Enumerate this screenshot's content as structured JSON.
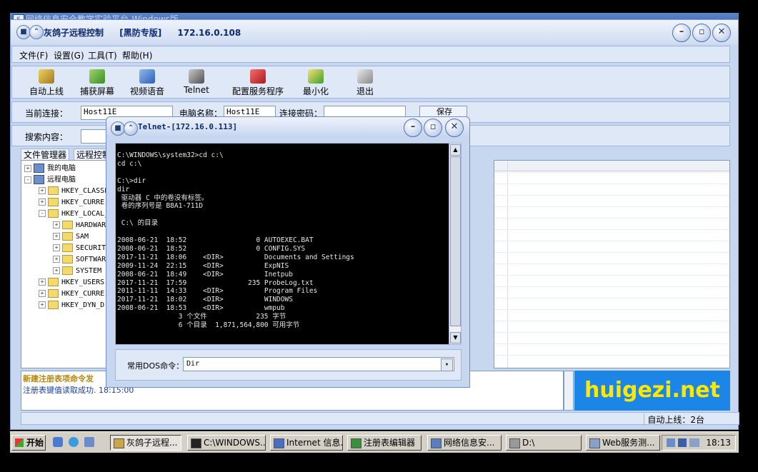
{
  "outer_window": {
    "title": "网络信息安全教学实验平台-Windows版"
  },
  "app": {
    "title": "灰鸽子远程控制",
    "edition": "[黑防专版]",
    "ip": "172.16.0.108"
  },
  "menu": [
    "文件(F)",
    "设置(G)",
    "工具(T)",
    "帮助(H)"
  ],
  "toolbar": [
    {
      "label": "自动上线",
      "icon": "auto-online-icon"
    },
    {
      "label": "捕获屏幕",
      "icon": "capture-screen-icon"
    },
    {
      "label": "视频语音",
      "icon": "video-voice-icon"
    },
    {
      "label": "Telnet",
      "icon": "telnet-icon"
    },
    {
      "label": "配置服务程序",
      "icon": "config-server-icon"
    },
    {
      "label": "最小化",
      "icon": "minimize-icon"
    },
    {
      "label": "退出",
      "icon": "exit-icon"
    }
  ],
  "connection": {
    "current_label": "当前连接：",
    "current_value": "Host11E",
    "computer_label": "电脑名称：",
    "computer_value": "Host11E",
    "password_label": "连接密码：",
    "password_value": "",
    "save_label": "保存"
  },
  "search": {
    "label": "搜索内容：",
    "value": ""
  },
  "tabs": [
    "文件管理器",
    "远程控制"
  ],
  "tree": [
    {
      "label": "我的电脑",
      "level": 0,
      "kind": "pc",
      "expander": "+"
    },
    {
      "label": "远程电脑",
      "level": 0,
      "kind": "pc",
      "expander": "-"
    },
    {
      "label": "HKEY_CLASSE",
      "level": 1,
      "kind": "folder",
      "expander": "+"
    },
    {
      "label": "HKEY_CURRE",
      "level": 1,
      "kind": "folder",
      "expander": "+"
    },
    {
      "label": "HKEY_LOCAL_",
      "level": 1,
      "kind": "folder",
      "expander": "-"
    },
    {
      "label": "HARDWAR",
      "level": 2,
      "kind": "folder",
      "expander": "+"
    },
    {
      "label": "SAM",
      "level": 2,
      "kind": "folder",
      "expander": "+"
    },
    {
      "label": "SECURIT",
      "level": 2,
      "kind": "folder",
      "expander": "+"
    },
    {
      "label": "SOFTWAR",
      "level": 2,
      "kind": "folder",
      "expander": "+"
    },
    {
      "label": "SYSTEM",
      "level": 2,
      "kind": "folder",
      "expander": "+"
    },
    {
      "label": "HKEY_USERS",
      "level": 1,
      "kind": "folder",
      "expander": "+"
    },
    {
      "label": "HKEY_CURRE",
      "level": 1,
      "kind": "folder",
      "expander": "+"
    },
    {
      "label": "HKEY_DYN_D",
      "level": 1,
      "kind": "folder",
      "expander": "+"
    }
  ],
  "log": {
    "line1": "新建注册表项命令发",
    "line2": "注册表键值读取成功. 18:15:00"
  },
  "logo": {
    "text": "huigezi.net",
    "bg": "#1c86e6",
    "color": "#ffe800"
  },
  "status": {
    "right": "自动上线：2台"
  },
  "telnet": {
    "title": "Telnet-[172.16.0.113]",
    "console_lines": [
      "C:\\WINDOWS\\system32>cd c:\\",
      "cd c:\\",
      "",
      "C:\\>dir",
      "dir",
      " 驱动器 C 中的卷没有标签。",
      " 卷的序列号是 B8A1-711D",
      "",
      " C:\\ 的目录",
      "",
      "2008-06-21  18:52                 0 AUTOEXEC.BAT",
      "2008-06-21  18:52                 0 CONFIG.SYS",
      "2017-11-21  18:06    <DIR>          Documents and Settings",
      "2009-11-24  22:15    <DIR>          ExpNIS",
      "2008-06-21  18:49    <DIR>          Inetpub",
      "2017-11-21  17:59               235 ProbeLog.txt",
      "2011-11-11  14:33    <DIR>          Program Files",
      "2017-11-21  18:02    <DIR>          WINDOWS",
      "2008-06-21  18:53    <DIR>          wmpub",
      "               3 个文件            235 字节",
      "               6 个目录  1,871,564,800 可用字节"
    ],
    "cmd_label": "常用DOS命令：",
    "cmd_value": "Dir"
  },
  "taskbar": {
    "start": "开始",
    "tasks": [
      {
        "label": "灰鸽子远程...",
        "active": true
      },
      {
        "label": "C:\\WINDOWS...",
        "active": false
      },
      {
        "label": "Internet 信息...",
        "active": false
      },
      {
        "label": "注册表编辑器",
        "active": false
      },
      {
        "label": "网络信息安...",
        "active": false
      },
      {
        "label": "D:\\",
        "active": false
      },
      {
        "label": "Web服务测...",
        "active": false
      }
    ],
    "clock": "18:13"
  }
}
